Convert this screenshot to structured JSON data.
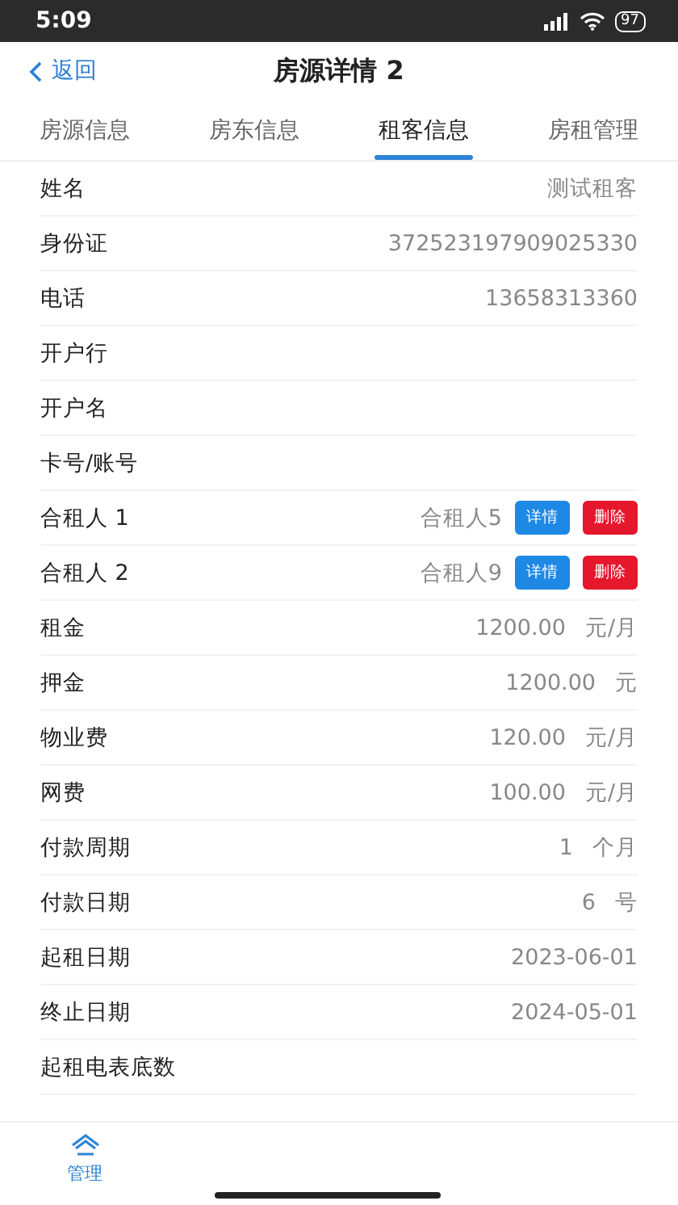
{
  "status_bar": {
    "time": "5:09",
    "battery": "97"
  },
  "header": {
    "back": "返回",
    "title": "房源详情 2"
  },
  "tabs": [
    {
      "label": "房源信息",
      "selected": false
    },
    {
      "label": "房东信息",
      "selected": false
    },
    {
      "label": "租客信息",
      "selected": true
    },
    {
      "label": "房租管理",
      "selected": false
    }
  ],
  "rows": [
    {
      "kind": "text",
      "label": "姓名",
      "value": "测试租客"
    },
    {
      "kind": "text",
      "label": "身份证",
      "value": "372523197909025330"
    },
    {
      "kind": "text",
      "label": "电话",
      "value": "13658313360"
    },
    {
      "kind": "text",
      "label": "开户行"
    },
    {
      "kind": "text",
      "label": "开户名"
    },
    {
      "kind": "text",
      "label": "卡号/账号"
    },
    {
      "kind": "partner",
      "label": "合租人 1",
      "value": "合租人5",
      "buttons": [
        {
          "kind": "detail",
          "label": "详情"
        },
        {
          "kind": "delete",
          "label": "删除"
        }
      ]
    },
    {
      "kind": "partner",
      "label": "合租人 2",
      "value": "合租人9",
      "buttons": [
        {
          "kind": "detail",
          "label": "详情"
        },
        {
          "kind": "delete",
          "label": "删除"
        }
      ]
    },
    {
      "kind": "text",
      "label": "租金",
      "value": "1200.00",
      "unit": "元/月"
    },
    {
      "kind": "text",
      "label": "押金",
      "value": "1200.00",
      "unit": "元"
    },
    {
      "kind": "text",
      "label": "物业费",
      "value": "120.00",
      "unit": "元/月"
    },
    {
      "kind": "text",
      "label": "网费",
      "value": "100.00",
      "unit": "元/月"
    },
    {
      "kind": "text",
      "label": "付款周期",
      "value": "1",
      "unit": "个月"
    },
    {
      "kind": "text",
      "label": "付款日期",
      "value": "6",
      "unit": "号"
    },
    {
      "kind": "text",
      "label": "起租日期",
      "value": "2023-06-01"
    },
    {
      "kind": "text",
      "label": "终止日期",
      "value": "2024-05-01"
    },
    {
      "kind": "text",
      "label": "起租电表底数"
    }
  ],
  "bottom_nav": [
    {
      "label": "管理",
      "selected": true
    }
  ]
}
